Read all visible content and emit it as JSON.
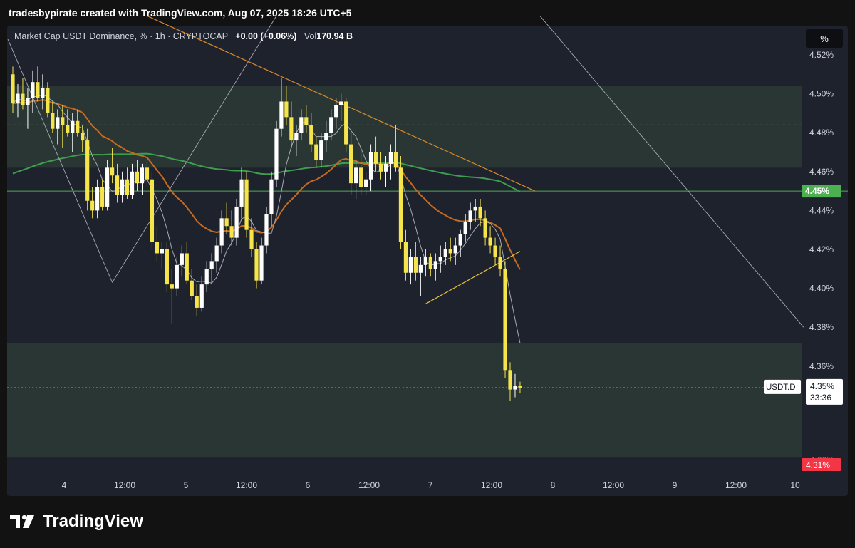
{
  "header": {
    "creator_line": "tradesbypirate created with TradingView.com, Aug 07, 2025 18:26 UTC+5"
  },
  "legend": {
    "symbol": "Market Cap USDT Dominance, % · 1h · CRYPTOCAP",
    "change": "+0.00 (+0.06%)",
    "vol_label": "Vol",
    "vol_value": "170.94 B"
  },
  "scale_button": {
    "label": "%"
  },
  "brand": {
    "name": "TradingView",
    "logo_icon": "tradingview-logo-icon"
  },
  "colors": {
    "bull_candle": "#ffffff",
    "bear_candle": "#f5e44a",
    "ema_orange": "#c76a1f",
    "ema_green": "#3d9f4e",
    "sma_white": "#a8abb3",
    "trendline_orange": "#d9892b",
    "trendline_yellow": "#e6c23a",
    "zone_fill": "#2b3a36",
    "price_line_green": "#4caf50",
    "label_red": "#f23645"
  },
  "chart_data": {
    "type": "candlestick",
    "y_axis": {
      "min": 4.305,
      "max": 4.535,
      "ticks": [
        "4.52%",
        "4.50%",
        "4.48%",
        "4.46%",
        "4.44%",
        "4.42%",
        "4.40%",
        "4.38%",
        "4.36%"
      ]
    },
    "x_axis": {
      "ticks": [
        "4",
        "12:00",
        "5",
        "12:00",
        "6",
        "12:00",
        "7",
        "12:00",
        "8",
        "12:00",
        "9",
        "12:00",
        "10"
      ]
    },
    "labels": {
      "level_green": "4.45%",
      "symbol_tag": "USDT.D",
      "last_price": "4.35%",
      "countdown": "33:36",
      "low_level": "4.31%",
      "hidden_tick": "4.32%"
    },
    "zones": [
      {
        "name": "upper-supply-zone",
        "from": 4.462,
        "to": 4.504
      },
      {
        "name": "lower-demand-zone",
        "from": 4.313,
        "to": 4.372
      }
    ],
    "horizontal_levels": {
      "resistance": 4.45,
      "zone_mid_dash": 4.484,
      "last_price": 4.349
    },
    "candles": [
      [
        4.51,
        4.514,
        4.49,
        4.495
      ],
      [
        4.495,
        4.505,
        4.488,
        4.5
      ],
      [
        4.5,
        4.508,
        4.492,
        4.494
      ],
      [
        4.494,
        4.503,
        4.482,
        4.498
      ],
      [
        4.498,
        4.512,
        4.49,
        4.506
      ],
      [
        4.506,
        4.514,
        4.496,
        4.498
      ],
      [
        4.498,
        4.51,
        4.492,
        4.503
      ],
      [
        4.503,
        4.506,
        4.488,
        4.49
      ],
      [
        4.49,
        4.496,
        4.48,
        4.482
      ],
      [
        4.482,
        4.492,
        4.474,
        4.488
      ],
      [
        4.488,
        4.494,
        4.472,
        4.484
      ],
      [
        4.484,
        4.492,
        4.478,
        4.48
      ],
      [
        4.48,
        4.49,
        4.47,
        4.486
      ],
      [
        4.486,
        4.492,
        4.478,
        4.48
      ],
      [
        4.48,
        4.484,
        4.47,
        4.476
      ],
      [
        4.476,
        4.482,
        4.44,
        4.445
      ],
      [
        4.445,
        4.452,
        4.436,
        4.44
      ],
      [
        4.44,
        4.456,
        4.436,
        4.452
      ],
      [
        4.452,
        4.456,
        4.44,
        4.442
      ],
      [
        4.442,
        4.466,
        4.44,
        4.462
      ],
      [
        4.462,
        4.472,
        4.454,
        4.458
      ],
      [
        4.458,
        4.464,
        4.444,
        4.448
      ],
      [
        4.448,
        4.46,
        4.444,
        4.456
      ],
      [
        4.456,
        4.462,
        4.446,
        4.448
      ],
      [
        4.448,
        4.464,
        4.446,
        4.46
      ],
      [
        4.46,
        4.466,
        4.45,
        4.454
      ],
      [
        4.454,
        4.464,
        4.448,
        4.462
      ],
      [
        4.462,
        4.466,
        4.452,
        4.456
      ],
      [
        4.456,
        4.46,
        4.42,
        4.424
      ],
      [
        4.424,
        4.432,
        4.414,
        4.418
      ],
      [
        4.418,
        4.424,
        4.41,
        4.42
      ],
      [
        4.42,
        4.424,
        4.398,
        4.402
      ],
      [
        4.402,
        4.41,
        4.382,
        4.4
      ],
      [
        4.4,
        4.416,
        4.396,
        4.412
      ],
      [
        4.412,
        4.422,
        4.406,
        4.418
      ],
      [
        4.418,
        4.424,
        4.402,
        4.404
      ],
      [
        4.404,
        4.41,
        4.394,
        4.396
      ],
      [
        4.396,
        4.402,
        4.386,
        4.39
      ],
      [
        4.39,
        4.406,
        4.388,
        4.402
      ],
      [
        4.402,
        4.414,
        4.398,
        4.41
      ],
      [
        4.41,
        4.418,
        4.402,
        4.414
      ],
      [
        4.414,
        4.426,
        4.408,
        4.422
      ],
      [
        4.422,
        4.44,
        4.418,
        4.436
      ],
      [
        4.436,
        4.444,
        4.428,
        4.432
      ],
      [
        4.432,
        4.44,
        4.422,
        4.426
      ],
      [
        4.426,
        4.446,
        4.422,
        4.442
      ],
      [
        4.442,
        4.462,
        4.436,
        4.456
      ],
      [
        4.456,
        4.46,
        4.426,
        4.43
      ],
      [
        4.43,
        4.436,
        4.416,
        4.42
      ],
      [
        4.42,
        4.424,
        4.4,
        4.404
      ],
      [
        4.404,
        4.426,
        4.402,
        4.422
      ],
      [
        4.422,
        4.442,
        4.418,
        4.438
      ],
      [
        4.438,
        4.46,
        4.432,
        4.456
      ],
      [
        4.456,
        4.486,
        4.452,
        4.482
      ],
      [
        4.482,
        4.508,
        4.478,
        4.496
      ],
      [
        4.496,
        4.504,
        4.484,
        4.488
      ],
      [
        4.488,
        4.496,
        4.472,
        4.476
      ],
      [
        4.476,
        4.484,
        4.468,
        4.48
      ],
      [
        4.48,
        4.492,
        4.476,
        4.488
      ],
      [
        4.488,
        4.494,
        4.48,
        4.484
      ],
      [
        4.484,
        4.49,
        4.47,
        4.474
      ],
      [
        4.474,
        4.478,
        4.462,
        4.466
      ],
      [
        4.466,
        4.48,
        4.462,
        4.476
      ],
      [
        4.476,
        4.486,
        4.47,
        4.48
      ],
      [
        4.48,
        4.492,
        4.476,
        4.488
      ],
      [
        4.488,
        4.498,
        4.482,
        4.494
      ],
      [
        4.494,
        4.5,
        4.486,
        4.496
      ],
      [
        4.496,
        4.498,
        4.47,
        4.474
      ],
      [
        4.474,
        4.48,
        4.448,
        4.454
      ],
      [
        4.454,
        4.466,
        4.446,
        4.462
      ],
      [
        4.462,
        4.47,
        4.448,
        4.452
      ],
      [
        4.452,
        4.46,
        4.448,
        4.456
      ],
      [
        4.456,
        4.474,
        4.45,
        4.47
      ],
      [
        4.47,
        4.478,
        4.46,
        4.464
      ],
      [
        4.464,
        4.47,
        4.456,
        4.46
      ],
      [
        4.46,
        4.468,
        4.452,
        4.464
      ],
      [
        4.464,
        4.474,
        4.456,
        4.47
      ],
      [
        4.47,
        4.484,
        4.46,
        4.462
      ],
      [
        4.462,
        4.468,
        4.42,
        4.424
      ],
      [
        4.424,
        4.43,
        4.404,
        4.408
      ],
      [
        4.408,
        4.42,
        4.402,
        4.416
      ],
      [
        4.416,
        4.424,
        4.404,
        4.408
      ],
      [
        4.408,
        4.416,
        4.396,
        4.412
      ],
      [
        4.412,
        4.42,
        4.406,
        4.416
      ],
      [
        4.416,
        4.418,
        4.406,
        4.41
      ],
      [
        4.41,
        4.418,
        4.404,
        4.414
      ],
      [
        4.414,
        4.422,
        4.408,
        4.416
      ],
      [
        4.416,
        4.424,
        4.412,
        4.42
      ],
      [
        4.42,
        4.426,
        4.414,
        4.418
      ],
      [
        4.418,
        4.426,
        4.412,
        4.422
      ],
      [
        4.422,
        4.43,
        4.416,
        4.428
      ],
      [
        4.428,
        4.438,
        4.424,
        4.434
      ],
      [
        4.434,
        4.444,
        4.43,
        4.44
      ],
      [
        4.44,
        4.446,
        4.434,
        4.442
      ],
      [
        4.442,
        4.446,
        4.432,
        4.436
      ],
      [
        4.436,
        4.44,
        4.422,
        4.426
      ],
      [
        4.426,
        4.432,
        4.418,
        4.422
      ],
      [
        4.422,
        4.426,
        4.412,
        4.416
      ],
      [
        4.416,
        4.422,
        4.406,
        4.41
      ],
      [
        4.41,
        4.414,
        4.354,
        4.358
      ],
      [
        4.358,
        4.362,
        4.342,
        4.348
      ],
      [
        4.348,
        4.356,
        4.344,
        4.35
      ],
      [
        4.35,
        4.352,
        4.346,
        4.349
      ]
    ]
  }
}
